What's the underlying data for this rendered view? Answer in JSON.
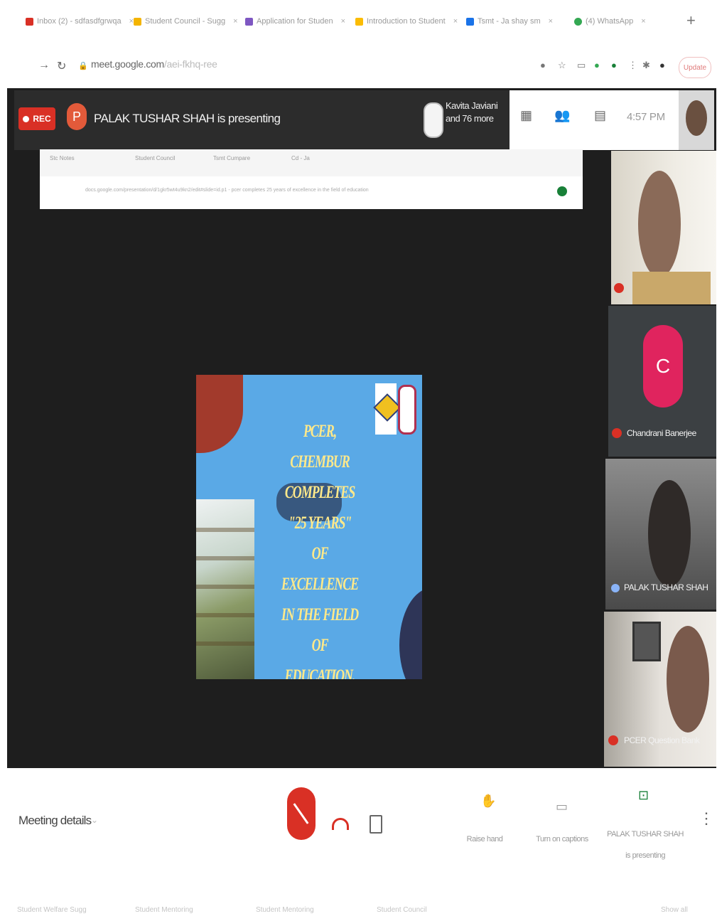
{
  "browser": {
    "tabs": [
      {
        "label": "Inbox (2) - sdfasdfgrwqa",
        "color": "#d93025"
      },
      {
        "label": "Student Council - Sugg",
        "color": "#f4b400"
      },
      {
        "label": "Application for Studen",
        "color": "#7e57c2"
      },
      {
        "label": "Introduction to Student",
        "color": "#fbbc04"
      },
      {
        "label": "Tsmt - Ja shay sm",
        "color": "#1a73e8"
      },
      {
        "label": "(4) WhatsApp",
        "color": "#34a853"
      }
    ],
    "new_tab": "+",
    "url_host": "meet.google.com",
    "url_rest": "/aei-fkhq-ree",
    "update_label": "Update"
  },
  "meet": {
    "rec_label": "REC",
    "presenter_initial": "P",
    "presenting_text": "PALAK TUSHAR SHAH is presenting",
    "others_line1": "Kavita Javiani",
    "others_line2": "and 76 more",
    "clock": "4:57 PM"
  },
  "shared_screen": {
    "tabs": [
      "Stc Notes",
      "Student Council",
      "Tsmt Cumpare",
      "Cd - Ja"
    ],
    "url": "docs.google.com/presentation/d/1gkr5wt4u9kn2/edit#slide=id.p1 - pcer completes 25 years of excellence in the field of education"
  },
  "slide": {
    "lines": [
      "PCER, CHEMBUR",
      "COMPLETES",
      "\"25 YEARS\"",
      "OF EXCELLENCE",
      "IN THE FIELD OF",
      "EDUCATION."
    ]
  },
  "participants": [
    {
      "name": "Chandrani Banerjee",
      "initial": "C"
    },
    {
      "name": "PALAK TUSHAR SHAH"
    },
    {
      "name": "PCER Question Bank"
    }
  ],
  "controls": {
    "meeting_details": "Meeting details",
    "raise_hand": "Raise hand",
    "captions": "Turn on captions",
    "present": "PALAK TUSHAR SHAH is presenting",
    "present_line1": "PALAK TUSHAR SHAH",
    "present_line2": "is presenting"
  },
  "bookmarks": [
    "Student Welfare Sugg",
    "Student Mentoring",
    "Student Mentoring",
    "Student Council",
    "Show all"
  ],
  "colors": {
    "rec": "#d93025",
    "stage": "#1e1e1e",
    "avatar_c": "#e0245e",
    "slide_bg": "#5aa9e6"
  }
}
